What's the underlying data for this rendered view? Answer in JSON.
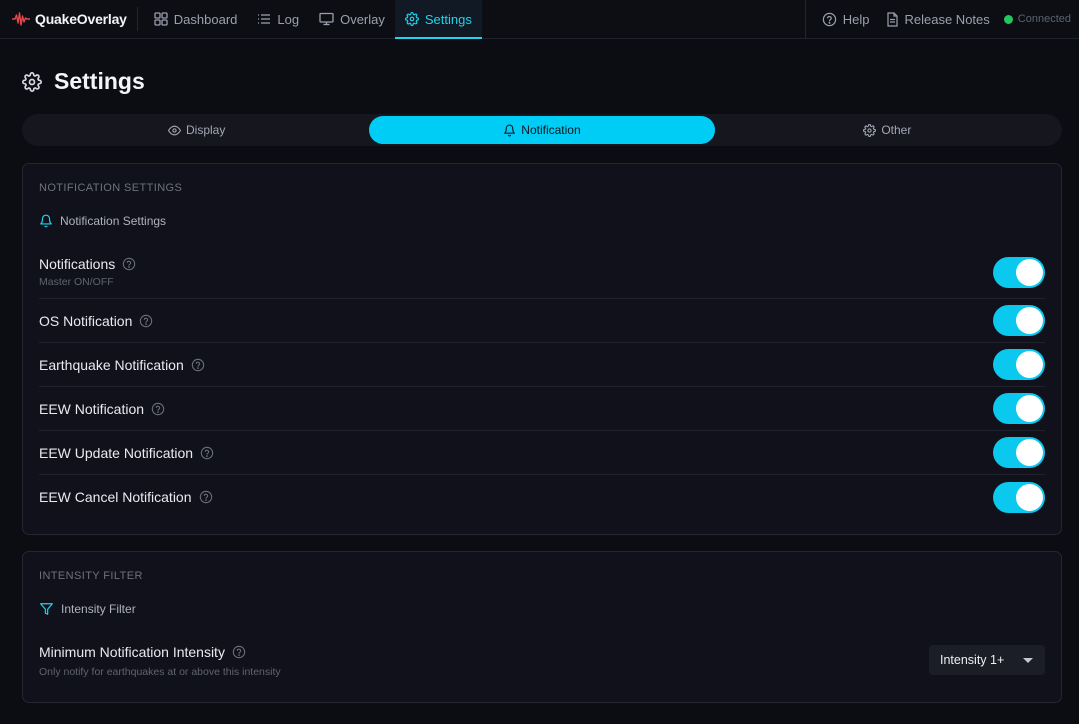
{
  "app": {
    "name": "QuakeOverlay"
  },
  "nav": [
    {
      "label": "Dashboard",
      "icon": "dashboard-icon",
      "active": false
    },
    {
      "label": "Log",
      "icon": "list-icon",
      "active": false
    },
    {
      "label": "Overlay",
      "icon": "monitor-icon",
      "active": false
    },
    {
      "label": "Settings",
      "icon": "gear-icon",
      "active": true
    }
  ],
  "topbar_right": {
    "help_label": "Help",
    "release_notes_label": "Release Notes",
    "status_text": "Connected",
    "status_color": "#22c55e"
  },
  "page": {
    "title": "Settings"
  },
  "tabs": [
    {
      "label": "Display",
      "icon": "eye-icon",
      "active": false
    },
    {
      "label": "Notification",
      "icon": "bell-icon",
      "active": true
    },
    {
      "label": "Other",
      "icon": "gear-icon",
      "active": false
    }
  ],
  "notification_section": {
    "label": "NOTIFICATION SETTINGS",
    "heading": "Notification Settings",
    "rows": [
      {
        "title": "Notifications",
        "subtitle": "Master ON/OFF",
        "enabled": true
      },
      {
        "title": "OS Notification",
        "enabled": true
      },
      {
        "title": "Earthquake Notification",
        "enabled": true
      },
      {
        "title": "EEW Notification",
        "enabled": true
      },
      {
        "title": "EEW Update Notification",
        "enabled": true
      },
      {
        "title": "EEW Cancel Notification",
        "enabled": true
      }
    ]
  },
  "intensity_section": {
    "label": "INTENSITY FILTER",
    "heading": "Intensity Filter",
    "setting_title": "Minimum Notification Intensity",
    "setting_subtitle": "Only notify for earthquakes at or above this intensity",
    "selected_value": "Intensity 1+"
  },
  "colors": {
    "accent": "#00cdf5",
    "background": "#0c0d13",
    "card": "#10111a",
    "brand_wave": "#e5484d"
  }
}
